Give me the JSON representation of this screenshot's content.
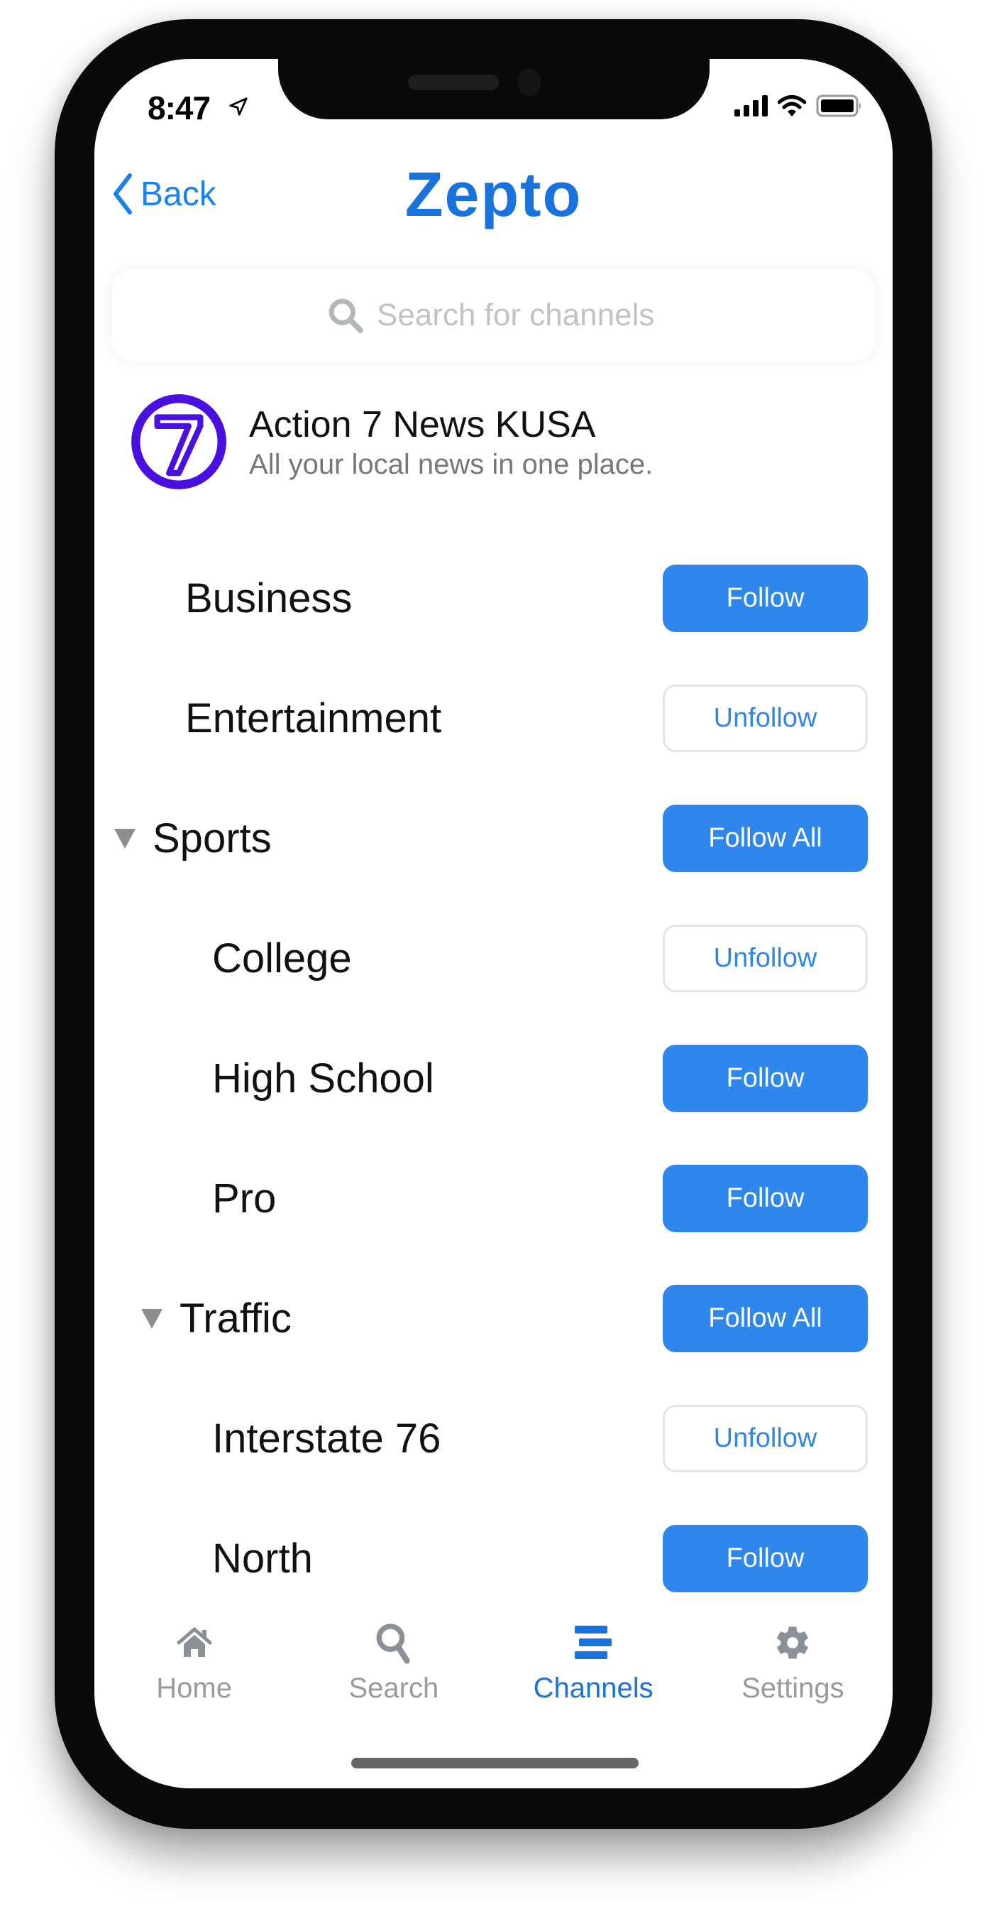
{
  "status_bar": {
    "time": "8:47",
    "icons": [
      "location-arrow-icon",
      "cellular-signal-icon",
      "wifi-icon",
      "battery-icon"
    ]
  },
  "nav": {
    "back_label": "Back",
    "app_title": "Zepto"
  },
  "search": {
    "placeholder": "Search for channels",
    "value": ""
  },
  "channel": {
    "name": "Action 7 News KUSA",
    "description": "All your local news in one place.",
    "logo_text": "7",
    "logo_color": "#4a10e0"
  },
  "topics": [
    {
      "label": "Business",
      "level": 1,
      "group": false,
      "expanded": null,
      "button": "Follow",
      "button_style": "primary"
    },
    {
      "label": "Entertainment",
      "level": 1,
      "group": false,
      "expanded": null,
      "button": "Unfollow",
      "button_style": "outline"
    },
    {
      "label": "Sports",
      "level": 1,
      "group": true,
      "expanded": true,
      "button": "Follow All",
      "button_style": "primary"
    },
    {
      "label": "College",
      "level": 2,
      "group": false,
      "expanded": null,
      "button": "Unfollow",
      "button_style": "outline"
    },
    {
      "label": "High School",
      "level": 2,
      "group": false,
      "expanded": null,
      "button": "Follow",
      "button_style": "primary"
    },
    {
      "label": "Pro",
      "level": 2,
      "group": false,
      "expanded": null,
      "button": "Follow",
      "button_style": "primary"
    },
    {
      "label": "Traffic",
      "level": 2,
      "group": true,
      "expanded": true,
      "button": "Follow All",
      "button_style": "primary"
    },
    {
      "label": "Interstate 76",
      "level": 2,
      "group": false,
      "expanded": null,
      "button": "Unfollow",
      "button_style": "outline"
    },
    {
      "label": "North",
      "level": 2,
      "group": false,
      "expanded": null,
      "button": "Follow",
      "button_style": "primary"
    }
  ],
  "tab_bar": {
    "active": "Channels",
    "tabs": [
      {
        "label": "Home",
        "icon": "home-icon"
      },
      {
        "label": "Search",
        "icon": "search-icon"
      },
      {
        "label": "Channels",
        "icon": "channels-icon"
      },
      {
        "label": "Settings",
        "icon": "gear-icon"
      }
    ]
  },
  "colors": {
    "accent": "#2f86eb",
    "brand": "#1a73dd",
    "back_link": "#1a82f0",
    "inactive_tab": "#8a9097",
    "outline_border": "#e4e4e4"
  }
}
